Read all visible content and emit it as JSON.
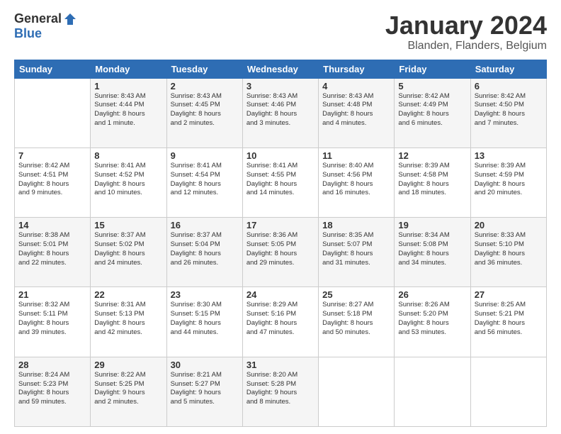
{
  "logo": {
    "general": "General",
    "blue": "Blue"
  },
  "header": {
    "month": "January 2024",
    "location": "Blanden, Flanders, Belgium"
  },
  "weekdays": [
    "Sunday",
    "Monday",
    "Tuesday",
    "Wednesday",
    "Thursday",
    "Friday",
    "Saturday"
  ],
  "weeks": [
    [
      {
        "day": "",
        "info": ""
      },
      {
        "day": "1",
        "info": "Sunrise: 8:43 AM\nSunset: 4:44 PM\nDaylight: 8 hours\nand 1 minute."
      },
      {
        "day": "2",
        "info": "Sunrise: 8:43 AM\nSunset: 4:45 PM\nDaylight: 8 hours\nand 2 minutes."
      },
      {
        "day": "3",
        "info": "Sunrise: 8:43 AM\nSunset: 4:46 PM\nDaylight: 8 hours\nand 3 minutes."
      },
      {
        "day": "4",
        "info": "Sunrise: 8:43 AM\nSunset: 4:48 PM\nDaylight: 8 hours\nand 4 minutes."
      },
      {
        "day": "5",
        "info": "Sunrise: 8:42 AM\nSunset: 4:49 PM\nDaylight: 8 hours\nand 6 minutes."
      },
      {
        "day": "6",
        "info": "Sunrise: 8:42 AM\nSunset: 4:50 PM\nDaylight: 8 hours\nand 7 minutes."
      }
    ],
    [
      {
        "day": "7",
        "info": "Sunrise: 8:42 AM\nSunset: 4:51 PM\nDaylight: 8 hours\nand 9 minutes."
      },
      {
        "day": "8",
        "info": "Sunrise: 8:41 AM\nSunset: 4:52 PM\nDaylight: 8 hours\nand 10 minutes."
      },
      {
        "day": "9",
        "info": "Sunrise: 8:41 AM\nSunset: 4:54 PM\nDaylight: 8 hours\nand 12 minutes."
      },
      {
        "day": "10",
        "info": "Sunrise: 8:41 AM\nSunset: 4:55 PM\nDaylight: 8 hours\nand 14 minutes."
      },
      {
        "day": "11",
        "info": "Sunrise: 8:40 AM\nSunset: 4:56 PM\nDaylight: 8 hours\nand 16 minutes."
      },
      {
        "day": "12",
        "info": "Sunrise: 8:39 AM\nSunset: 4:58 PM\nDaylight: 8 hours\nand 18 minutes."
      },
      {
        "day": "13",
        "info": "Sunrise: 8:39 AM\nSunset: 4:59 PM\nDaylight: 8 hours\nand 20 minutes."
      }
    ],
    [
      {
        "day": "14",
        "info": "Sunrise: 8:38 AM\nSunset: 5:01 PM\nDaylight: 8 hours\nand 22 minutes."
      },
      {
        "day": "15",
        "info": "Sunrise: 8:37 AM\nSunset: 5:02 PM\nDaylight: 8 hours\nand 24 minutes."
      },
      {
        "day": "16",
        "info": "Sunrise: 8:37 AM\nSunset: 5:04 PM\nDaylight: 8 hours\nand 26 minutes."
      },
      {
        "day": "17",
        "info": "Sunrise: 8:36 AM\nSunset: 5:05 PM\nDaylight: 8 hours\nand 29 minutes."
      },
      {
        "day": "18",
        "info": "Sunrise: 8:35 AM\nSunset: 5:07 PM\nDaylight: 8 hours\nand 31 minutes."
      },
      {
        "day": "19",
        "info": "Sunrise: 8:34 AM\nSunset: 5:08 PM\nDaylight: 8 hours\nand 34 minutes."
      },
      {
        "day": "20",
        "info": "Sunrise: 8:33 AM\nSunset: 5:10 PM\nDaylight: 8 hours\nand 36 minutes."
      }
    ],
    [
      {
        "day": "21",
        "info": "Sunrise: 8:32 AM\nSunset: 5:11 PM\nDaylight: 8 hours\nand 39 minutes."
      },
      {
        "day": "22",
        "info": "Sunrise: 8:31 AM\nSunset: 5:13 PM\nDaylight: 8 hours\nand 42 minutes."
      },
      {
        "day": "23",
        "info": "Sunrise: 8:30 AM\nSunset: 5:15 PM\nDaylight: 8 hours\nand 44 minutes."
      },
      {
        "day": "24",
        "info": "Sunrise: 8:29 AM\nSunset: 5:16 PM\nDaylight: 8 hours\nand 47 minutes."
      },
      {
        "day": "25",
        "info": "Sunrise: 8:27 AM\nSunset: 5:18 PM\nDaylight: 8 hours\nand 50 minutes."
      },
      {
        "day": "26",
        "info": "Sunrise: 8:26 AM\nSunset: 5:20 PM\nDaylight: 8 hours\nand 53 minutes."
      },
      {
        "day": "27",
        "info": "Sunrise: 8:25 AM\nSunset: 5:21 PM\nDaylight: 8 hours\nand 56 minutes."
      }
    ],
    [
      {
        "day": "28",
        "info": "Sunrise: 8:24 AM\nSunset: 5:23 PM\nDaylight: 8 hours\nand 59 minutes."
      },
      {
        "day": "29",
        "info": "Sunrise: 8:22 AM\nSunset: 5:25 PM\nDaylight: 9 hours\nand 2 minutes."
      },
      {
        "day": "30",
        "info": "Sunrise: 8:21 AM\nSunset: 5:27 PM\nDaylight: 9 hours\nand 5 minutes."
      },
      {
        "day": "31",
        "info": "Sunrise: 8:20 AM\nSunset: 5:28 PM\nDaylight: 9 hours\nand 8 minutes."
      },
      {
        "day": "",
        "info": ""
      },
      {
        "day": "",
        "info": ""
      },
      {
        "day": "",
        "info": ""
      }
    ]
  ]
}
